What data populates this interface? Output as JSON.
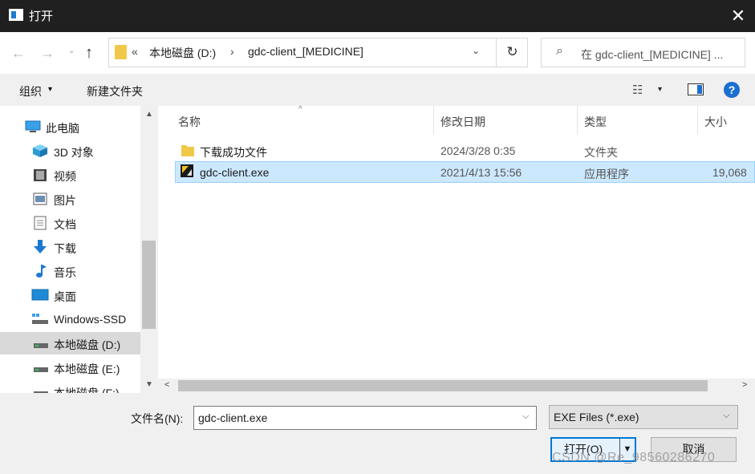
{
  "window": {
    "title": "打开",
    "close": "✕"
  },
  "nav": {
    "back": "←",
    "forward": "→",
    "recent": "⌄",
    "up": "↑",
    "address_sep": "«",
    "crumb_sep": "›",
    "crumbs": [
      "本地磁盘 (D:)",
      "gdc-client_[MEDICINE]"
    ],
    "dropdown": "⌄",
    "refresh": "↻",
    "search_placeholder": "在 gdc-client_[MEDICINE] ..."
  },
  "toolbar": {
    "organize": "组织",
    "new_folder": "新建文件夹",
    "view_icon": "☷",
    "caret": "▾",
    "help": "?"
  },
  "sidebar": {
    "items": [
      {
        "label": "此电脑",
        "icon": "computer-icon"
      },
      {
        "label": "3D 对象",
        "icon": "cube-icon"
      },
      {
        "label": "视频",
        "icon": "video-icon"
      },
      {
        "label": "图片",
        "icon": "picture-icon"
      },
      {
        "label": "文档",
        "icon": "document-icon"
      },
      {
        "label": "下载",
        "icon": "download-icon"
      },
      {
        "label": "音乐",
        "icon": "music-icon"
      },
      {
        "label": "桌面",
        "icon": "desktop-icon"
      },
      {
        "label": "Windows-SSD",
        "icon": "drive-icon"
      },
      {
        "label": "本地磁盘 (D:)",
        "icon": "drive-icon"
      },
      {
        "label": "本地磁盘 (E:)",
        "icon": "drive-icon"
      },
      {
        "label": "本地磁盘 (F:)",
        "icon": "drive-icon"
      }
    ],
    "selected": "本地磁盘 (D:)",
    "scroll_up": "▲",
    "scroll_down": "▼"
  },
  "filelist": {
    "columns": [
      "名称",
      "修改日期",
      "类型",
      "大小"
    ],
    "sort_caret": "^",
    "rows": [
      {
        "name": "下载成功文件",
        "date": "2024/3/28 0:35",
        "type": "文件夹",
        "size": "",
        "icon": "folder-icon"
      },
      {
        "name": "gdc-client.exe",
        "date": "2021/4/13 15:56",
        "type": "应用程序",
        "size": "19,068",
        "icon": "exe-icon",
        "selected": true
      }
    ],
    "h_left": "<",
    "h_right": ">"
  },
  "footer": {
    "filename_label": "文件名(N):",
    "filename_value": "gdc-client.exe",
    "filetype": "EXE Files (*.exe)",
    "open": "打开(O)",
    "split_caret": "▼",
    "cancel": "取消",
    "dropdown": "⌵"
  },
  "watermark": "CSDN @Re_98560286270",
  "colors": {
    "accent": "#0078d7",
    "selection": "#cce8ff",
    "folder": "#f2c84b"
  }
}
